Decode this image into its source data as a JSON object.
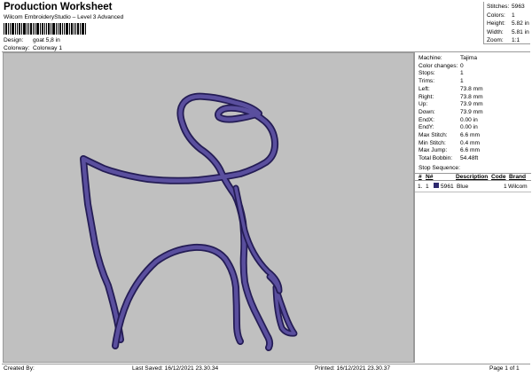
{
  "header": {
    "title": "Production Worksheet",
    "subtitle": "Wilcom EmbroideryStudio – Level 3 Advanced",
    "design_label": "Design:",
    "design_value": "goat 5,8 in",
    "colorway_label": "Colorway:",
    "colorway_value": "Colorway 1"
  },
  "summary": {
    "stitches_label": "Stitches:",
    "stitches_value": "5963",
    "colors_label": "Colors:",
    "colors_value": "1",
    "height_label": "Height:",
    "height_value": "5.82 in",
    "width_label": "Width:",
    "width_value": "5.81 in",
    "zoom_label": "Zoom:",
    "zoom_value": "1:1"
  },
  "details": [
    {
      "label": "Machine:",
      "value": "Tajima"
    },
    {
      "label": "Color changes:",
      "value": "0"
    },
    {
      "label": "Stops:",
      "value": "1"
    },
    {
      "label": "Trims:",
      "value": "1"
    },
    {
      "label": "Left:",
      "value": "73.8 mm"
    },
    {
      "label": "Right:",
      "value": "73.8 mm"
    },
    {
      "label": "Up:",
      "value": "73.9 mm"
    },
    {
      "label": "Down:",
      "value": "73.9 mm"
    },
    {
      "label": "EndX:",
      "value": "0.00 in"
    },
    {
      "label": "EndY:",
      "value": "0.00 in"
    },
    {
      "label": "Max Stitch:",
      "value": "6.6 mm"
    },
    {
      "label": "Min Stitch:",
      "value": "0.4 mm"
    },
    {
      "label": "Max Jump:",
      "value": "6.6 mm"
    },
    {
      "label": "Total Bobbin:",
      "value": "54.48ft"
    }
  ],
  "stop_sequence": {
    "title": "Stop Sequence:",
    "col_n": "#",
    "col_no": "N#",
    "col_desc": "Description",
    "col_code": "Code",
    "col_brand": "Brand",
    "rows": [
      {
        "n": "1.",
        "no": "1",
        "swatch": "#2e2a6e",
        "stitches": "5961",
        "desc": "Blue",
        "code": "1",
        "brand": "Wilcom"
      }
    ]
  },
  "design_colors": {
    "background": "#c0c0c0",
    "thread_dark": "#241c55",
    "thread_fill": "#5a4f9e"
  },
  "footer": {
    "created_by": "Created By:",
    "last_saved": "Last Saved: 16/12/2021 23.30.34",
    "printed": "Printed: 16/12/2021 23.30.37",
    "page": "Page 1 of 1"
  }
}
